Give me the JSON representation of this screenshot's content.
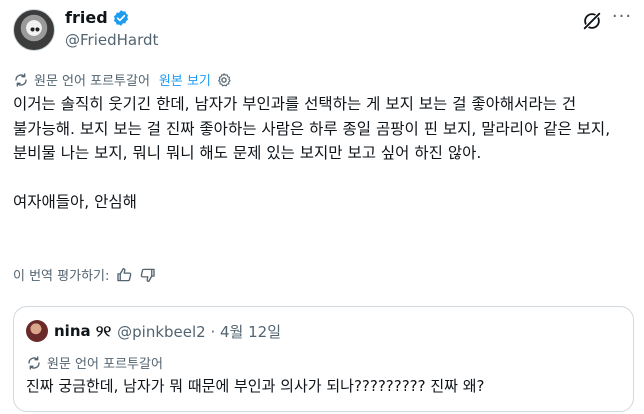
{
  "author": {
    "display_name": "fried",
    "handle": "@FriedHardt"
  },
  "translation_bar": {
    "label": "원문 언어 포르투갈어",
    "show_original": "원본 보기"
  },
  "tweet": {
    "paragraph1": "이거는 솔직히 웃기긴 한데, 남자가 부인과를 선택하는 게 보지 보는 걸 좋아해서라는 건 불가능해. 보지 보는 걸 진짜 좋아하는 사람은 하루 종일 곰팡이 핀 보지, 말라리아 같은 보지, 분비물 나는 보지, 뭐니 뭐니 해도 문제 있는 보지만 보고 싶어 하진 않아.",
    "paragraph2": "여자애들아, 안심해"
  },
  "rate_translation": {
    "label": "이 번역 평가하기:"
  },
  "quote": {
    "display_name": "nina ୨୧",
    "handle_date": "@pinkbeel2 · 4월 12일",
    "translation_label": "원문 언어 포르투갈어",
    "text": "진짜 궁금한데, 남자가 뭐 때문에 부인과 의사가 되나????????? 진짜 왜?"
  },
  "colors": {
    "accent": "#1d9bf0",
    "secondary_text": "#536471",
    "border": "#cfd9de"
  },
  "icons": [
    "verified-badge-icon",
    "grok-icon",
    "more-icon",
    "translate-icon",
    "settings-icon",
    "thumbs-up-icon",
    "thumbs-down-icon"
  ]
}
